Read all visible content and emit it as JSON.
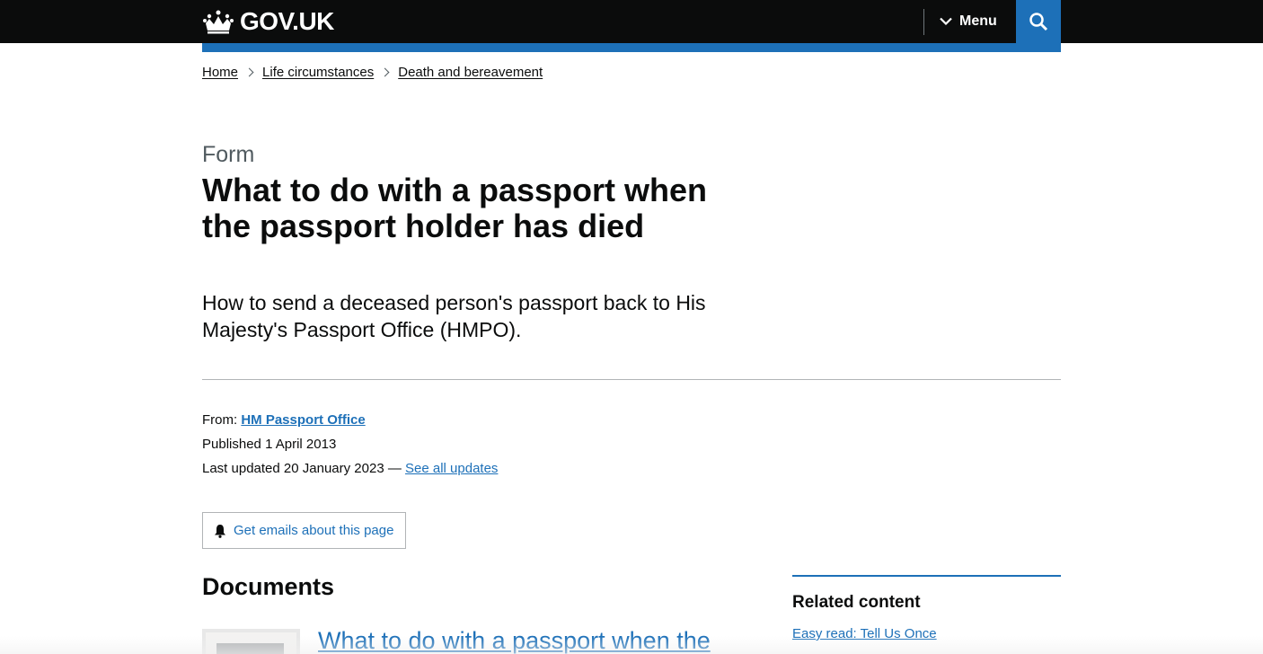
{
  "header": {
    "logo_text": "GOV.UK",
    "menu_label": "Menu",
    "accent_color": "#1d70b8"
  },
  "breadcrumbs": [
    "Home",
    "Life circumstances",
    "Death and bereavement"
  ],
  "page": {
    "caption": "Form",
    "title": "What to do with a passport when the passport holder has died",
    "lede": "How to send a deceased person's passport back to His Majesty's Passport Office (HMPO)."
  },
  "meta": {
    "from_label": "From:",
    "from_org": "HM Passport Office",
    "published_label": "Published",
    "published_date": "1 April 2013",
    "updated_label": "Last updated",
    "updated_date": "20 January 2023 —",
    "see_updates": "See all updates"
  },
  "email_button": "Get emails about this page",
  "documents": {
    "heading": "Documents",
    "items": [
      {
        "title": "What to do with a passport when the"
      }
    ]
  },
  "related": {
    "heading": "Related content",
    "links": [
      "Easy read: Tell Us Once"
    ]
  }
}
